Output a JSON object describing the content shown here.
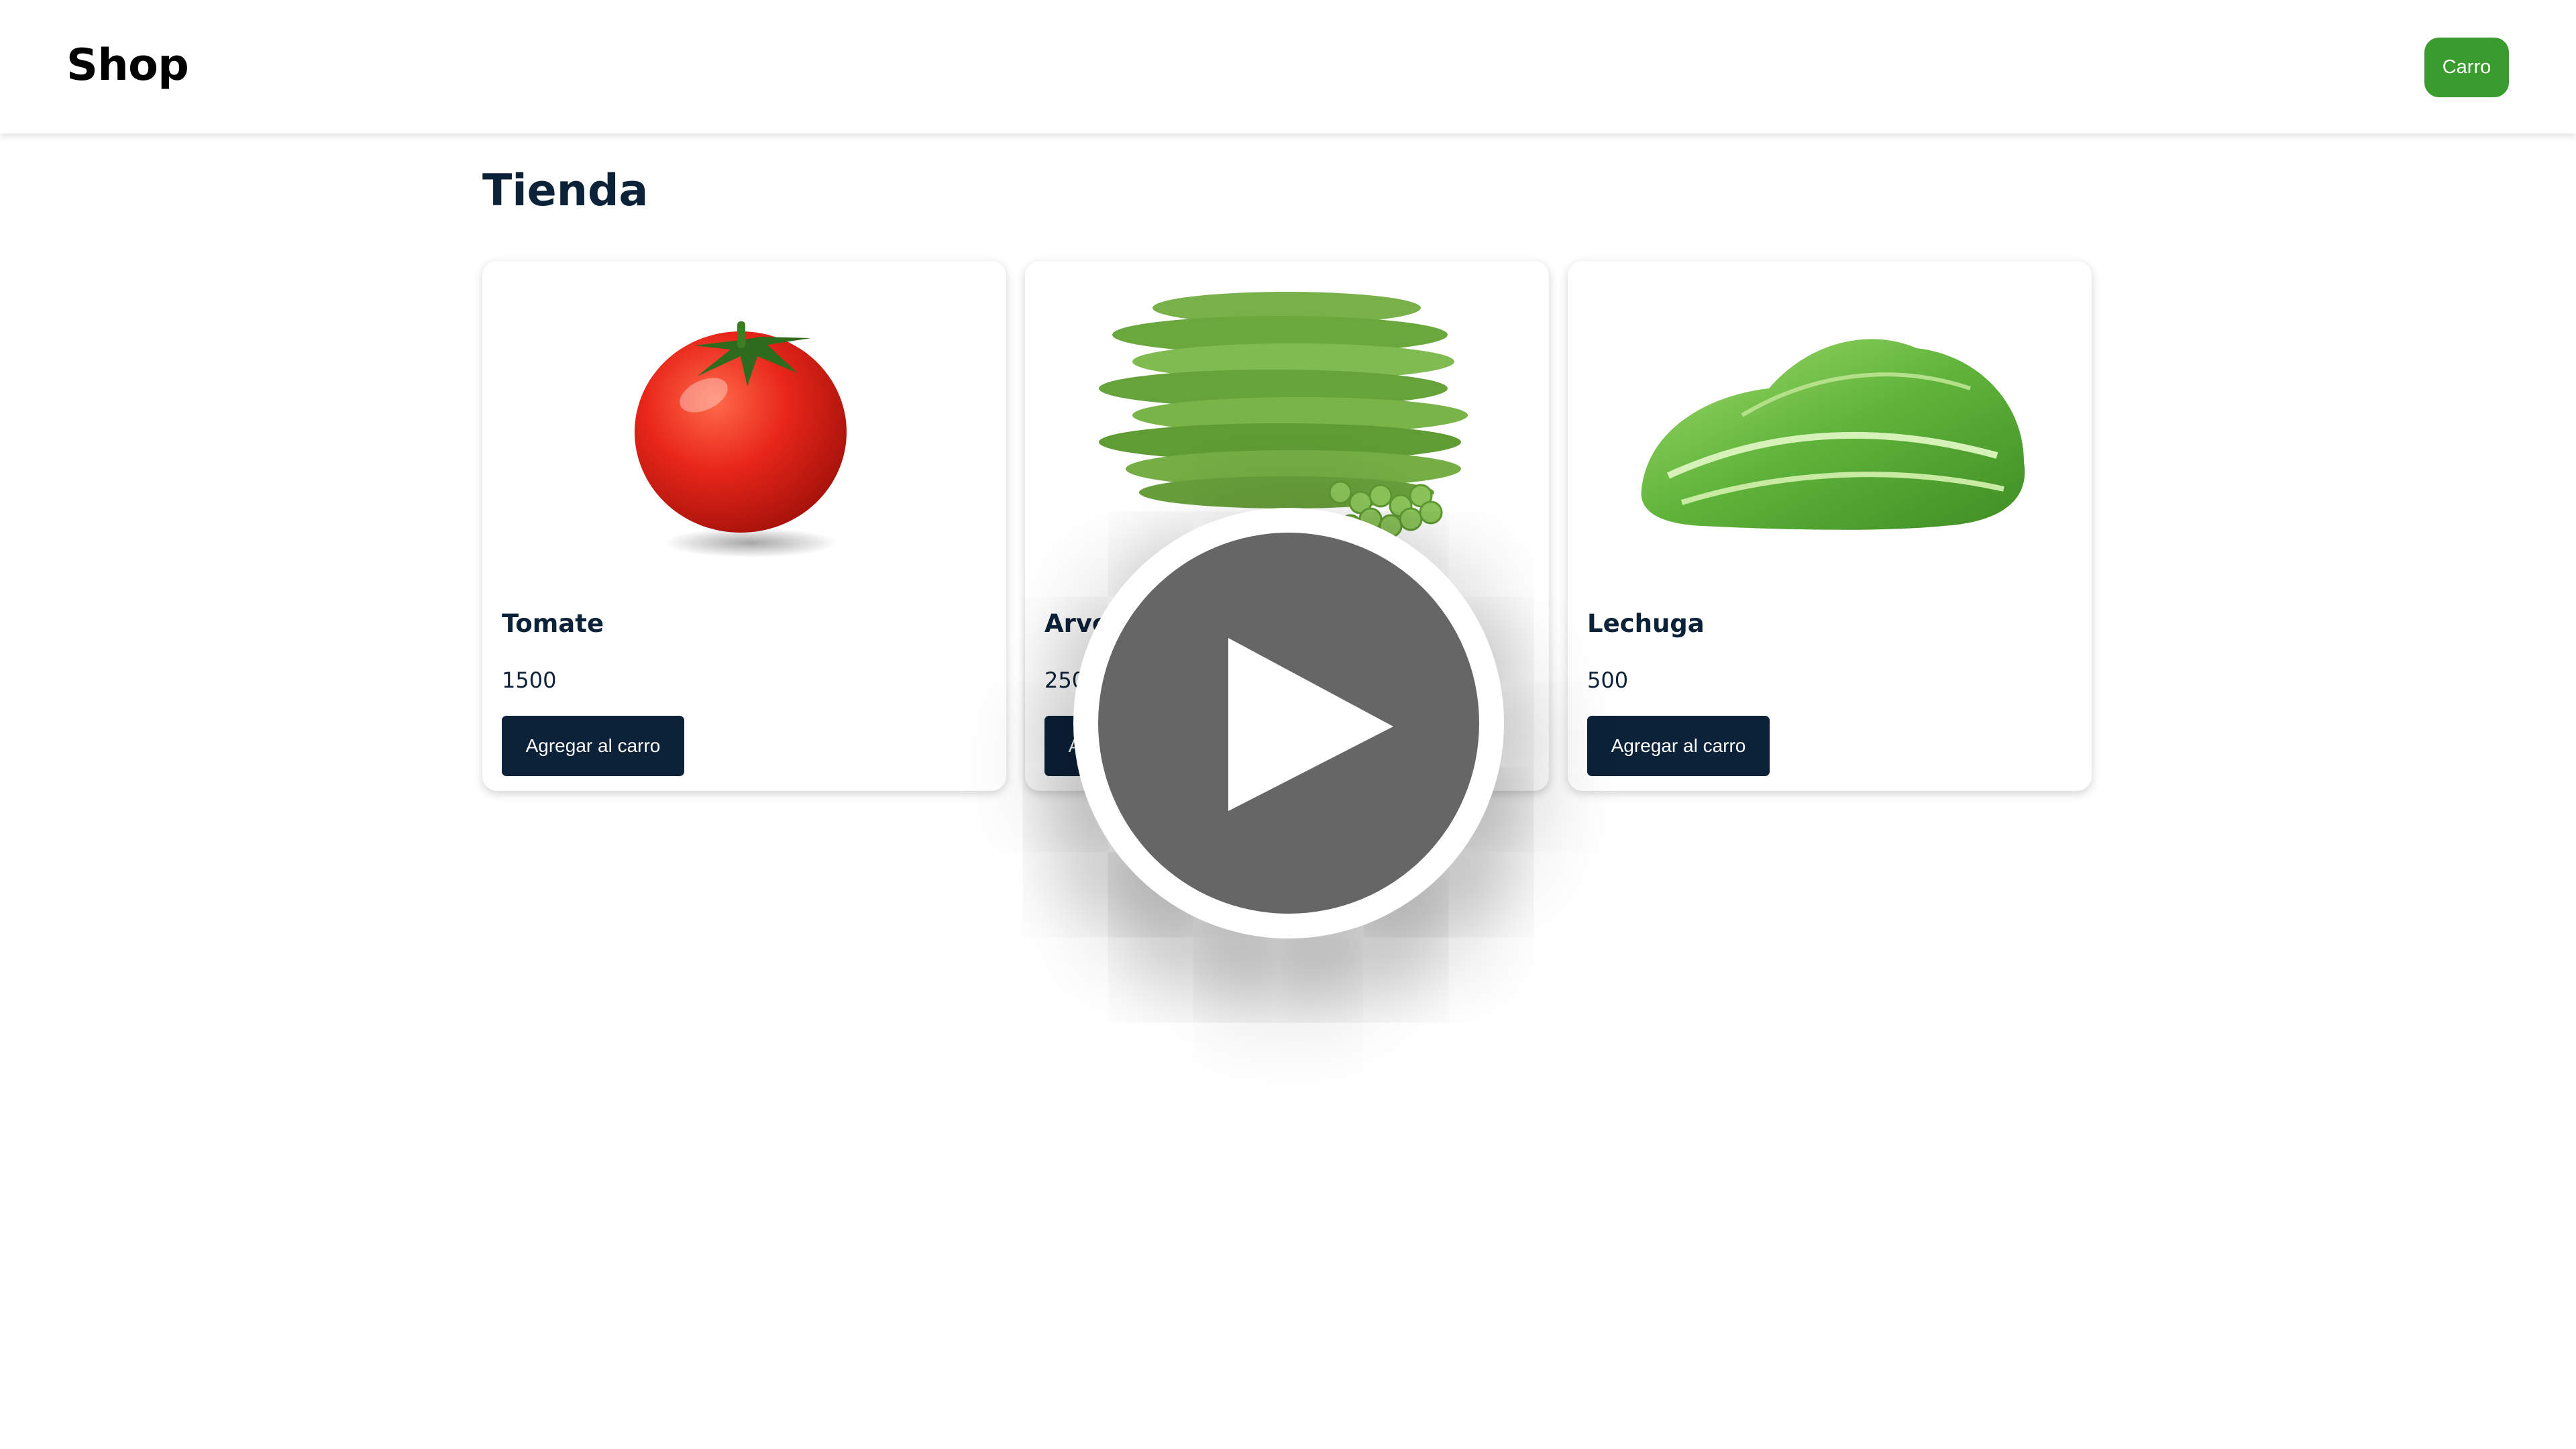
{
  "navbar": {
    "brand": "Shop",
    "cart_label": "Carro"
  },
  "main": {
    "title": "Tienda",
    "products": [
      {
        "name": "Tomate",
        "price": "1500",
        "button_label": "Agregar al carro"
      },
      {
        "name": "Arvejas",
        "price": "2500",
        "button_label": "Agregar al carro"
      },
      {
        "name": "Lechuga",
        "price": "500",
        "button_label": "Agregar al carro"
      }
    ]
  },
  "overlay": {
    "icon": "play-icon"
  },
  "colors": {
    "navy": "#0b2239",
    "cart_green": "#3a9b2e",
    "overlay_gray": "#666666"
  }
}
